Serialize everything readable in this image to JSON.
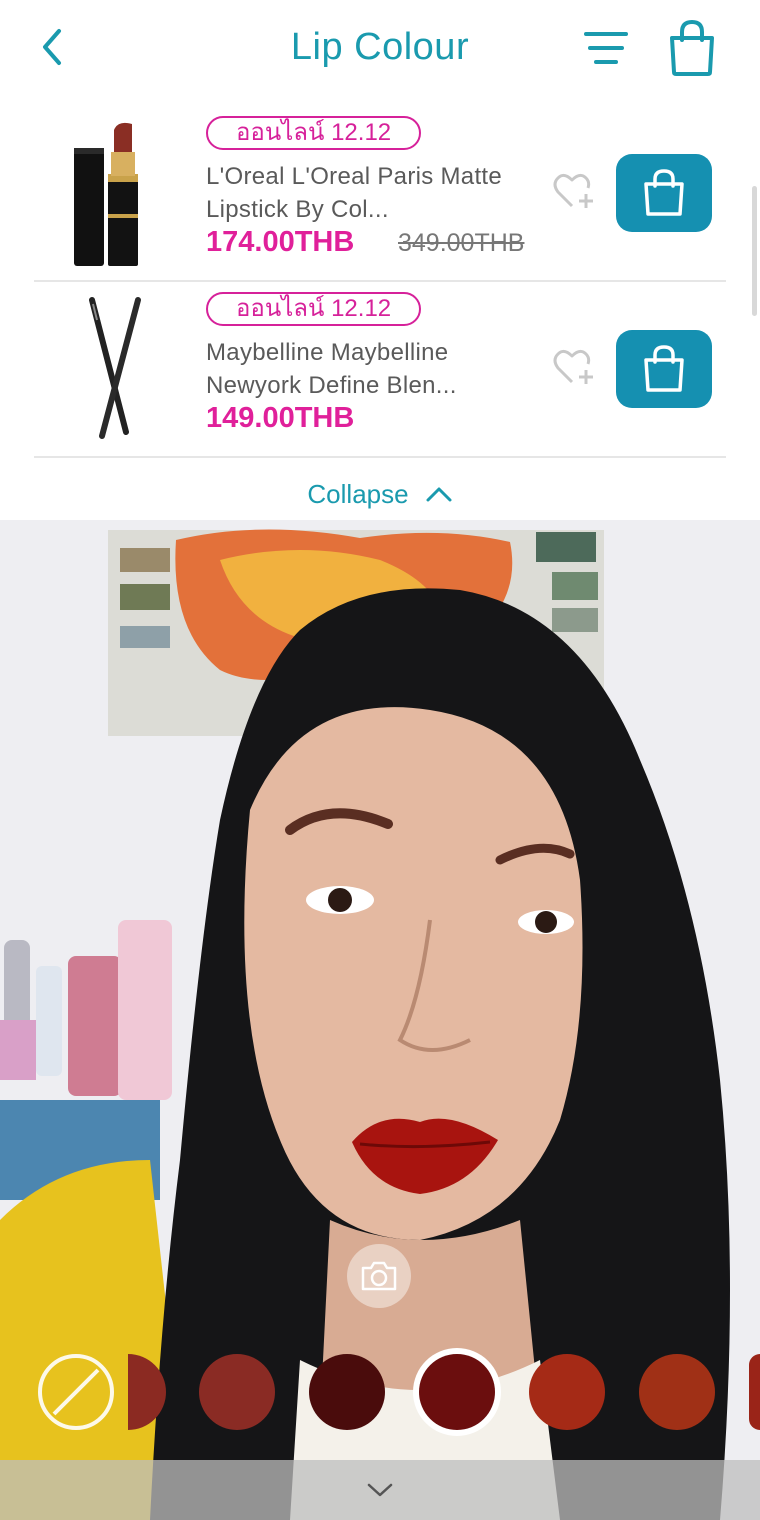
{
  "header": {
    "title": "Lip Colour",
    "back_icon": "chevron-left-icon",
    "filter_icon": "filter-lines-icon",
    "bag_icon": "shopping-bag-icon"
  },
  "products": [
    {
      "badge": "ออนไลน์ 12.12",
      "name": "L'Oreal L'Oreal Paris Matte Lipstick By Col...",
      "price": "174.00THB",
      "old_price": "349.00THB"
    },
    {
      "badge": "ออนไลน์ 12.12",
      "name": "Maybelline Maybelline Newyork Define Blen...",
      "price": "149.00THB",
      "old_price": ""
    }
  ],
  "collapse_label": "Collapse",
  "swatches": [
    {
      "color": "#8b2a22"
    },
    {
      "color": "#8a2b24"
    },
    {
      "color": "#4a0c0c"
    },
    {
      "color": "#6b0e0e",
      "selected": true
    },
    {
      "color": "#a52a16"
    },
    {
      "color": "#a03016"
    },
    {
      "color": "#9a2418"
    }
  ],
  "colors": {
    "accent": "#1a9aae",
    "cart_button": "#1590b1",
    "price_pink": "#e0209a"
  }
}
